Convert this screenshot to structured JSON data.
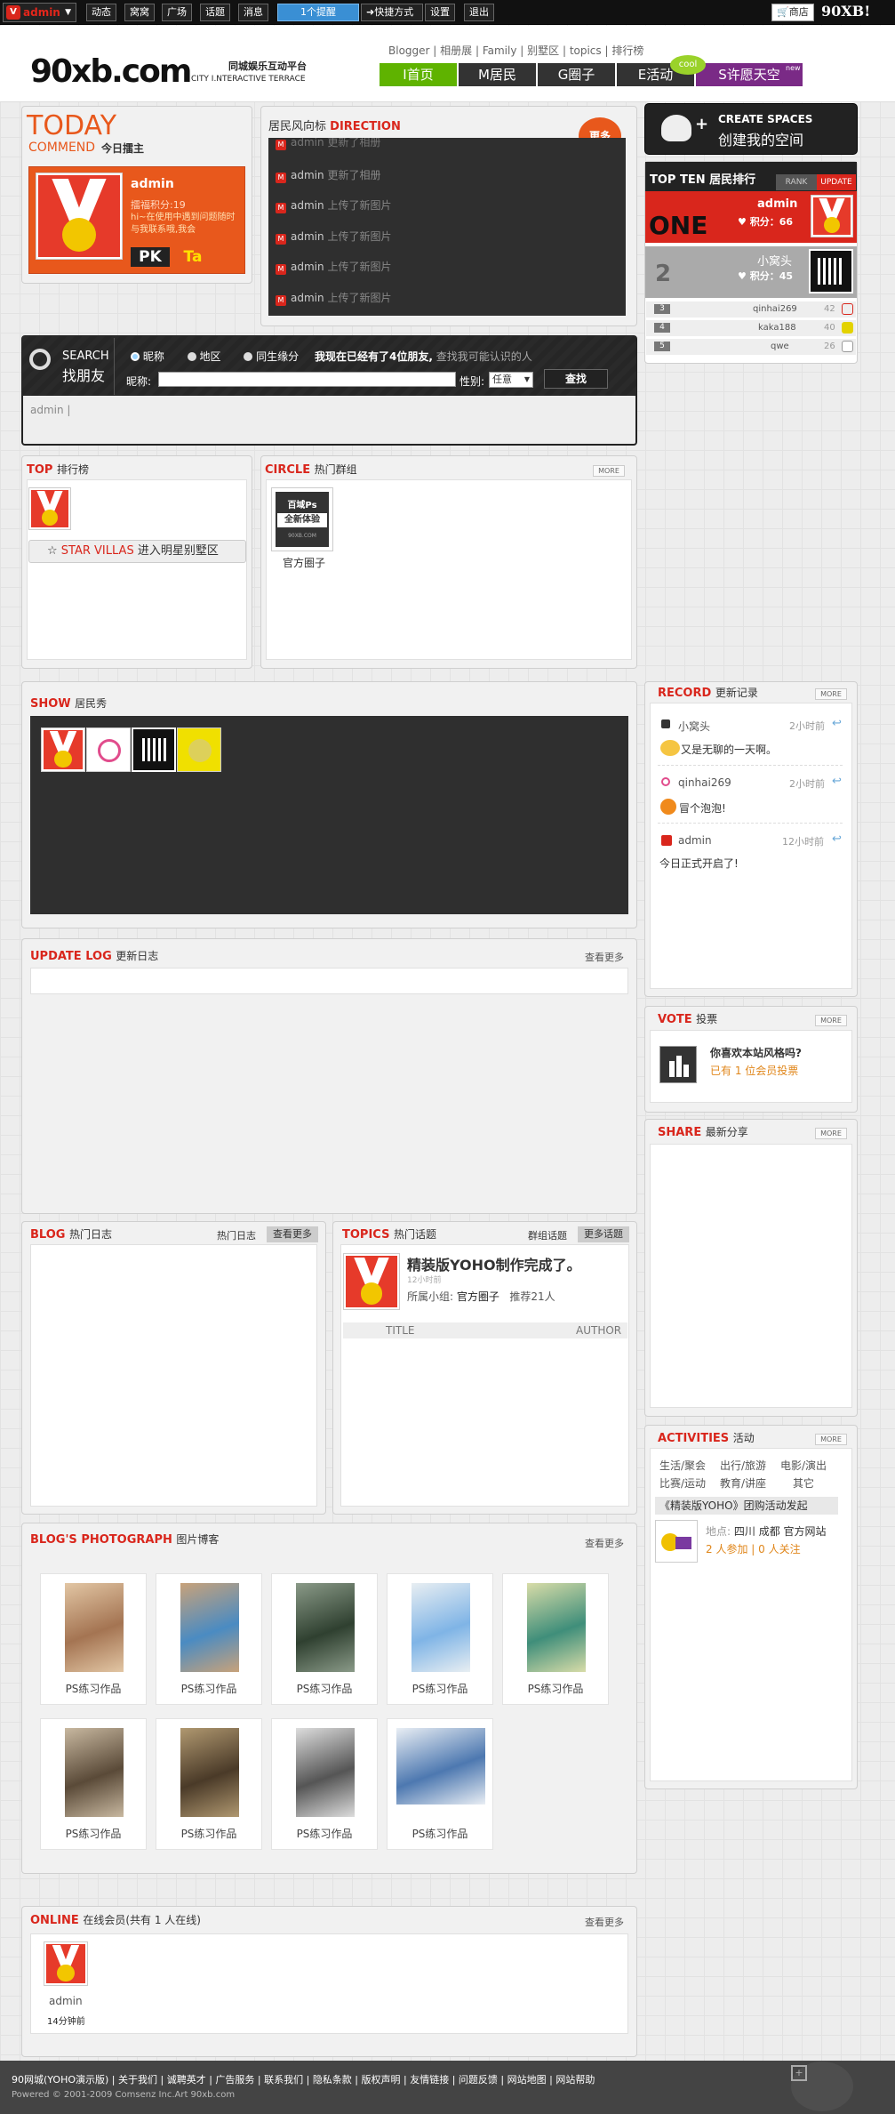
{
  "topbar": {
    "user": "admin",
    "links": [
      "动态",
      "窝窝",
      "广场",
      "话题",
      "消息"
    ],
    "notice": "1个提醒",
    "links2": [
      "快捷方式",
      "设置",
      "退出"
    ],
    "shop": "商店",
    "brand_small": "90XB!"
  },
  "header": {
    "logo": "90xb.com",
    "tagline_cn": "同城娱乐互动平台",
    "tagline_en": "CITY I.NTERACTIVE TERRACE",
    "sublinks": [
      "Blogger",
      "相册展",
      "Family",
      "别墅区",
      "topics",
      "排行榜"
    ],
    "nav": [
      "I首页",
      "M居民",
      "G圈子",
      "E活动",
      "S许愿天空"
    ],
    "cool": "cool",
    "new": "new"
  },
  "today": {
    "title": "TODAY",
    "sub": "COMMEND",
    "sub_cn": "今日擂主",
    "name": "admin",
    "points": "擂福积分:19",
    "desc": "hi~在使用中遇到问题随时与我联系哦,我会",
    "pk": "PK",
    "ta": "Ta"
  },
  "direction": {
    "title_cn": "居民风向标",
    "title_en": "DIRECTION",
    "more": "更多",
    "rows": [
      {
        "user": "admin",
        "action": "更新了相册"
      },
      {
        "user": "admin",
        "action": "上传了新图片"
      },
      {
        "user": "admin",
        "action": "上传了新图片"
      },
      {
        "user": "admin",
        "action": "上传了新图片"
      },
      {
        "user": "admin",
        "action": "上传了新图片"
      }
    ]
  },
  "create": {
    "en": "CREATE SPACES",
    "cn": "创建我的空间"
  },
  "topten": {
    "title": "TOP TEN 居民排行",
    "rank": "RANK",
    "update": "UPDATE",
    "one": "ONE",
    "first": {
      "name": "admin",
      "points": "积分：66"
    },
    "second": {
      "num": "2",
      "name": "小窝头",
      "points": "积分：45"
    },
    "rest": [
      {
        "num": "3",
        "name": "qinhai269",
        "score": "42"
      },
      {
        "num": "4",
        "name": "kaka188",
        "score": "40"
      },
      {
        "num": "5",
        "name": "qwe",
        "score": "26"
      }
    ]
  },
  "search": {
    "en": "SEARCH",
    "cn": "找朋友",
    "opts": [
      "昵称",
      "地区",
      "同生缘分"
    ],
    "status_pre": "我现在已经有了",
    "status_num": "4",
    "status_post": "位朋友,",
    "status_hint": "查找我可能认识的人",
    "nick_label": "昵称:",
    "gender_label": "性别:",
    "gender_value": "任意",
    "button": "查找",
    "result": "admin |"
  },
  "top": {
    "title": "TOP",
    "title_cn": "排行榜",
    "star_en": "STAR VILLAS",
    "star_cn": "进入明星别墅区"
  },
  "circle": {
    "title": "CIRCLE",
    "title_cn": "热门群组",
    "more": "MORE",
    "name": "官方圈子",
    "badge1": "百域Ps",
    "badge2": "全新体验",
    "badge3": "90XB.COM"
  },
  "show": {
    "title": "SHOW",
    "title_cn": "居民秀"
  },
  "record": {
    "title": "RECORD",
    "title_cn": "更新记录",
    "more": "MORE",
    "items": [
      {
        "user": "小窝头",
        "time": "2小时前",
        "text": "又是无聊的一天啊。"
      },
      {
        "user": "qinhai269",
        "time": "2小时前",
        "text": "冒个泡泡!"
      },
      {
        "user": "admin",
        "time": "12小时前",
        "text": "今日正式开启了!"
      }
    ]
  },
  "updatelog": {
    "title": "UPDATE LOG",
    "title_cn": "更新日志",
    "more": "查看更多"
  },
  "vote": {
    "title": "VOTE",
    "title_cn": "投票",
    "more": "MORE",
    "question": "你喜欢本站风格吗?",
    "count": "已有 1 位会员投票"
  },
  "share": {
    "title": "SHARE",
    "title_cn": "最新分享",
    "more": "MORE"
  },
  "blog": {
    "title": "BLOG",
    "title_cn": "热门日志",
    "tab1": "热门日志",
    "tab2": "查看更多"
  },
  "topics": {
    "title": "TOPICS",
    "title_cn": "热门话题",
    "tab1": "群组话题",
    "tab2": "更多话题",
    "headline": "精装版YOHO制作完成了。",
    "time": "12小时前",
    "group_label": "所属小组:",
    "group": "官方圈子",
    "recommend": "推荐21人",
    "col1": "TITLE",
    "col2": "AUTHOR"
  },
  "activities": {
    "title": "ACTIVITIES",
    "title_cn": "活动",
    "more": "MORE",
    "cats": [
      "生活/聚会",
      "出行/旅游",
      "电影/演出",
      "比赛/运动",
      "教育/讲座",
      "其它"
    ],
    "event": "《精装版YOHO》团购活动发起",
    "place_label": "地点:",
    "place": "四川 成都 官方网站",
    "join": "2 人参加",
    "follow": "0 人关注"
  },
  "photos": {
    "title": "BLOG'S PHOTOGRAPH",
    "title_cn": "图片博客",
    "more": "查看更多",
    "items": [
      {
        "cap": "PS练习作品",
        "c1": "#a47452",
        "c2": "#e2c6a4"
      },
      {
        "cap": "PS练习作品",
        "c1": "#4a8bc2",
        "c2": "#c8a27a"
      },
      {
        "cap": "PS练习作品",
        "c1": "#2f4030",
        "c2": "#8a9a88"
      },
      {
        "cap": "PS练习作品",
        "c1": "#7fb4e6",
        "c2": "#e8eef2"
      },
      {
        "cap": "PS练习作品",
        "c1": "#3f8e7a",
        "c2": "#d8dca8"
      },
      {
        "cap": "PS练习作品",
        "c1": "#5a4a38",
        "c2": "#c8b8a0"
      },
      {
        "cap": "PS练习作品",
        "c1": "#4a3a28",
        "c2": "#b09870"
      },
      {
        "cap": "PS练习作品",
        "c1": "#555555",
        "c2": "#dddddd"
      },
      {
        "cap": "PS练习作品",
        "c1": "#4d78b0",
        "c2": "#e9eef4"
      }
    ]
  },
  "online": {
    "title": "ONLINE",
    "title_cn": "在线会员(共有 1 人在线)",
    "more": "查看更多",
    "user": "admin",
    "time": "14分钟前"
  },
  "footer": {
    "links": [
      "90网城(YOHO演示版)",
      "关于我们",
      "诚聘英才",
      "广告服务",
      "联系我们",
      "隐私条款",
      "版权声明",
      "友情链接",
      "问题反馈",
      "网站地图",
      "网站帮助"
    ],
    "powered": "Powered © 2001-2009 Comsenz Inc.Art 90xb.com"
  }
}
